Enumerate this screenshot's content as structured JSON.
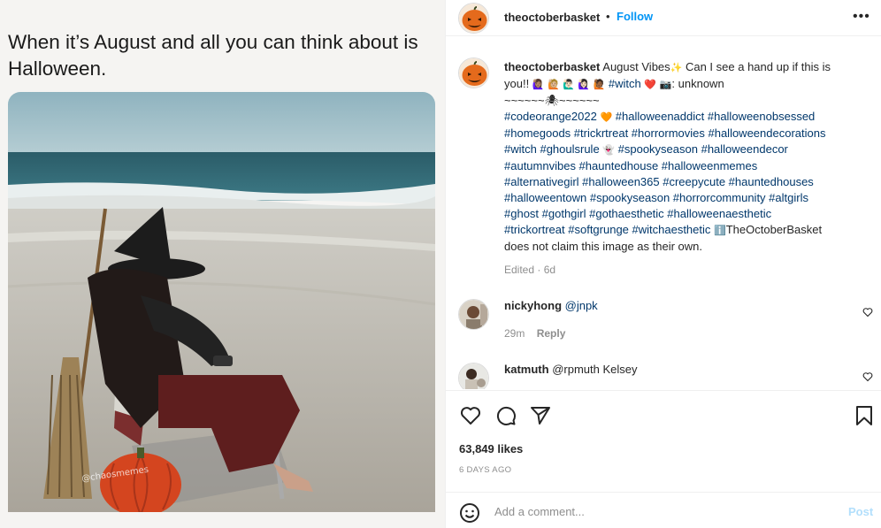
{
  "media": {
    "caption": "When it’s August and all you can think about is Halloween.",
    "watermark": "@chaosmemes"
  },
  "header": {
    "username": "theoctoberbasket",
    "separator": "•",
    "follow_label": "Follow",
    "more_icon": "more-horizontal-icon"
  },
  "caption": {
    "username": "theoctoberbasket",
    "text_1": "August Vibes",
    "text_2": " Can I see a hand up if this is you!! ",
    "emoji_row": "🙋🏽‍♀️ 🙋🏼 🙋🏻‍♂️ 🙋🏻‍♀️ 🙋🏾",
    "witch_tag": "#witch",
    "camera_text": ": unknown",
    "divider": "~~~~~~🕷~~~~~~",
    "tags_line": [
      "#codeorange2022",
      "#halloweenaddict #halloweenobsessed",
      "#homegoods #trickrtreat #horrormovies #halloweendecorations",
      "#witch #ghoulsrule",
      "#spookyseason #halloweendecor",
      "#autumnvibes #hauntedhouse #halloweenmemes",
      "#alternativegirl #halloween365 #creepycute #hauntedhouses",
      "#halloweentown #spookyseason #horrorcommunity #altgirls",
      "#ghost #gothgirl #gothaesthetic #halloweenaesthetic",
      "#trickortreat #softgrunge #witchaesthetic"
    ],
    "disclaimer_1": "TheOctoberBasket",
    "disclaimer_2": "does not claim this image as their own.",
    "edited": "Edited · 6d"
  },
  "comments": [
    {
      "username": "nickyhong",
      "text": "@jnpk",
      "time": "29m",
      "reply_label": "Reply"
    },
    {
      "username": "katmuth",
      "text": "@rpmuth Kelsey"
    }
  ],
  "actions": {
    "likes": "63,849 likes",
    "date": "6 DAYS AGO",
    "icons": [
      "heart-icon",
      "comment-icon",
      "share-icon",
      "bookmark-icon"
    ]
  },
  "add_comment": {
    "placeholder": "Add a comment...",
    "post_label": "Post"
  },
  "colors": {
    "accent": "#0095f6",
    "link": "#00376b",
    "muted": "#8e8e8e",
    "post_disabled": "#b2dffc"
  }
}
